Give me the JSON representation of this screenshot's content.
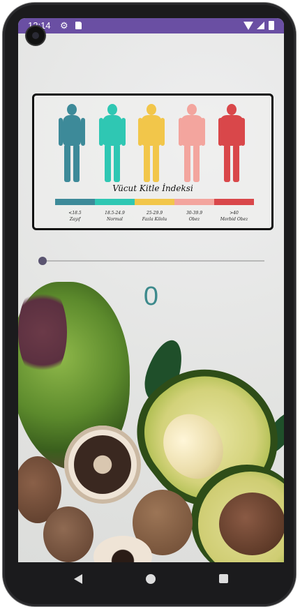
{
  "status_bar": {
    "time": "12:14",
    "icons": [
      "gear-icon",
      "sdcard-icon",
      "wifi-icon",
      "signal-icon",
      "battery-icon"
    ]
  },
  "bmi_chart": {
    "title": "Vücut Kitle İndeksi",
    "figures": [
      {
        "name": "figure-zayif",
        "color": "#3d8a99"
      },
      {
        "name": "figure-normal",
        "color": "#2fc7b3"
      },
      {
        "name": "figure-fazla-kilolu",
        "color": "#f2c64a"
      },
      {
        "name": "figure-obez",
        "color": "#f3a59e"
      },
      {
        "name": "figure-morbid-obez",
        "color": "#d9474a"
      }
    ],
    "categories": [
      {
        "range": "<18.5",
        "label": "Zayıf",
        "color": "#3d8a99"
      },
      {
        "range": "18.5-24.9",
        "label": "Normal",
        "color": "#2fc7b3"
      },
      {
        "range": "25-29.9",
        "label": "Fazla Kilolu",
        "color": "#f2c64a"
      },
      {
        "range": "30-39.9",
        "label": "Obez",
        "color": "#f3a59e"
      },
      {
        "range": ">40",
        "label": "Morbid Obez",
        "color": "#d9474a"
      }
    ]
  },
  "slider": {
    "value": 0
  },
  "result": {
    "value": "0",
    "color": "#3d8a8c"
  },
  "navigation": {
    "buttons": [
      "back-icon",
      "home-icon",
      "recents-icon"
    ]
  }
}
